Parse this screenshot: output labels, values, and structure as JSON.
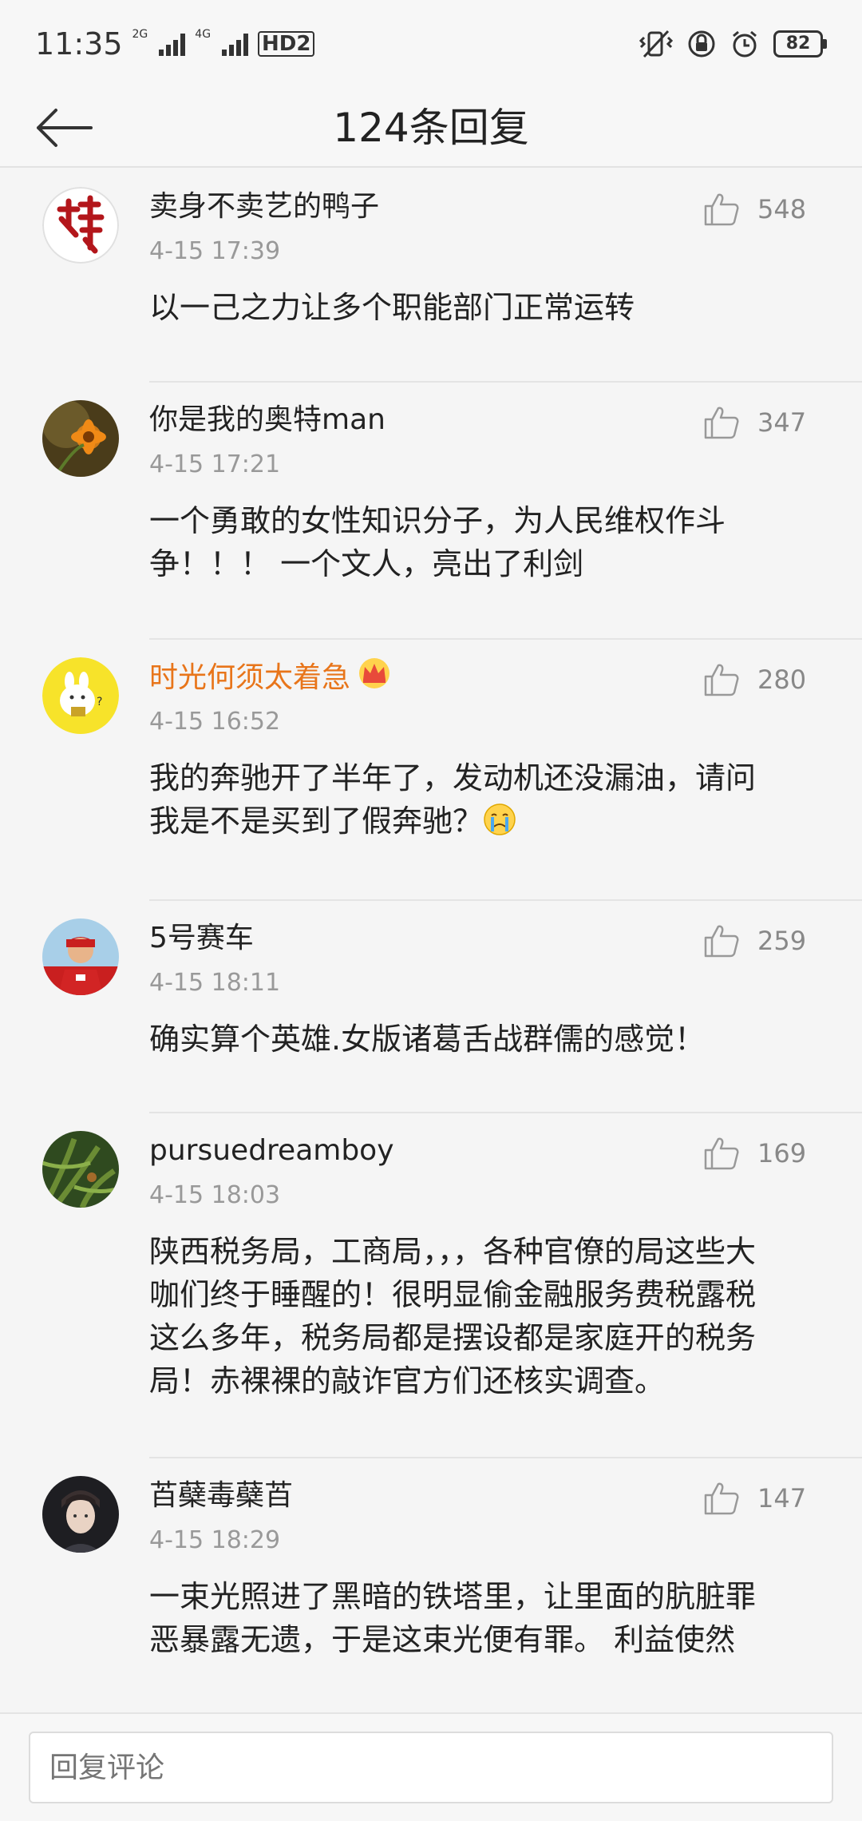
{
  "status_bar": {
    "time": "11:35",
    "network_1": "2G",
    "network_2": "4G",
    "hd_badge": "HD2",
    "battery": "82"
  },
  "header": {
    "title": "124条回复"
  },
  "comments": [
    {
      "user": "卖身不卖艺的鸭子",
      "time": "4-15 17:39",
      "likes": "548",
      "text": "以一己之力让多个职能部门正常运转"
    },
    {
      "user": "你是我的奥特man",
      "time": "4-15 17:21",
      "likes": "347",
      "text": "一个勇敢的女性知识分子，为人民维权作斗争！！！ 一个文人，亮出了利剑"
    },
    {
      "user": "时光何须太着急",
      "time": "4-15 16:52",
      "likes": "280",
      "text": "我的奔驰开了半年了，发动机还没漏油，请问我是不是买到了假奔驰？"
    },
    {
      "user": "5号赛车",
      "time": "4-15 18:11",
      "likes": "259",
      "text": "确实算个英雄.女版诸葛舌战群儒的感觉！"
    },
    {
      "user": "pursuedreamboy",
      "time": "4-15 18:03",
      "likes": "169",
      "text": "陕西税务局，工商局，，，各种官僚的局这些大咖们终于睡醒的！很明显偷金融服务费税露税这么多年，税务局都是摆设都是家庭开的税务局！赤裸裸的敲诈官方们还核实调查。"
    },
    {
      "user": "苩蘗毒蘗苩",
      "time": "4-15 18:29",
      "likes": "147",
      "text": "一束光照进了黑暗的铁塔里，让里面的肮脏罪恶暴露无遗，于是这束光便有罪。 利益使然"
    }
  ],
  "reply_bar": {
    "placeholder": "回复评论"
  },
  "colors": {
    "vip_username": "#e8751a",
    "meta_gray": "#999999",
    "background": "#f5f5f5"
  }
}
